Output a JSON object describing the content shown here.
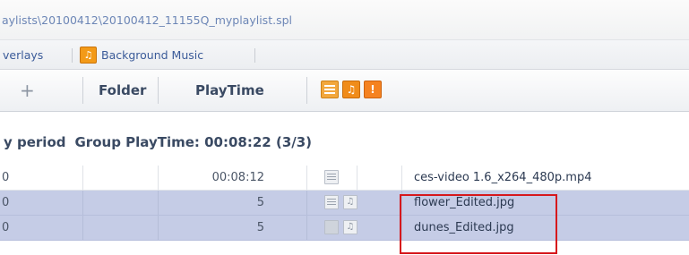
{
  "path_bar": {
    "text": "aylists\\20100412\\20100412_11155Q_myplaylist.spl"
  },
  "tabs": {
    "overlays_label": "verlays",
    "background_music_label": "Background Music",
    "background_music_icon": "music-note-icon"
  },
  "columns": {
    "add_glyph": "+",
    "folder": "Folder",
    "playtime": "PlayTime",
    "icons": [
      "list-icon",
      "music-icon",
      "info-icon"
    ]
  },
  "group": {
    "period_label": "y period",
    "playtime_label": "Group PlayTime: 00:08:22 (3/3)"
  },
  "rows": [
    {
      "index": "0",
      "playtime": "00:08:12",
      "icon": "list-icon",
      "filename": "ces-video 1.6_x264_480p.mp4",
      "selected": false
    },
    {
      "index": "0",
      "playtime": "5",
      "icon": "list-icon",
      "filename": "flower_Edited.jpg",
      "selected": true
    },
    {
      "index": "0",
      "playtime": "5",
      "icon": "box-icon",
      "filename": "dunes_Edited.jpg",
      "selected": true
    }
  ],
  "highlight_color": "#d6181c",
  "selection_color": "#c5cce6"
}
